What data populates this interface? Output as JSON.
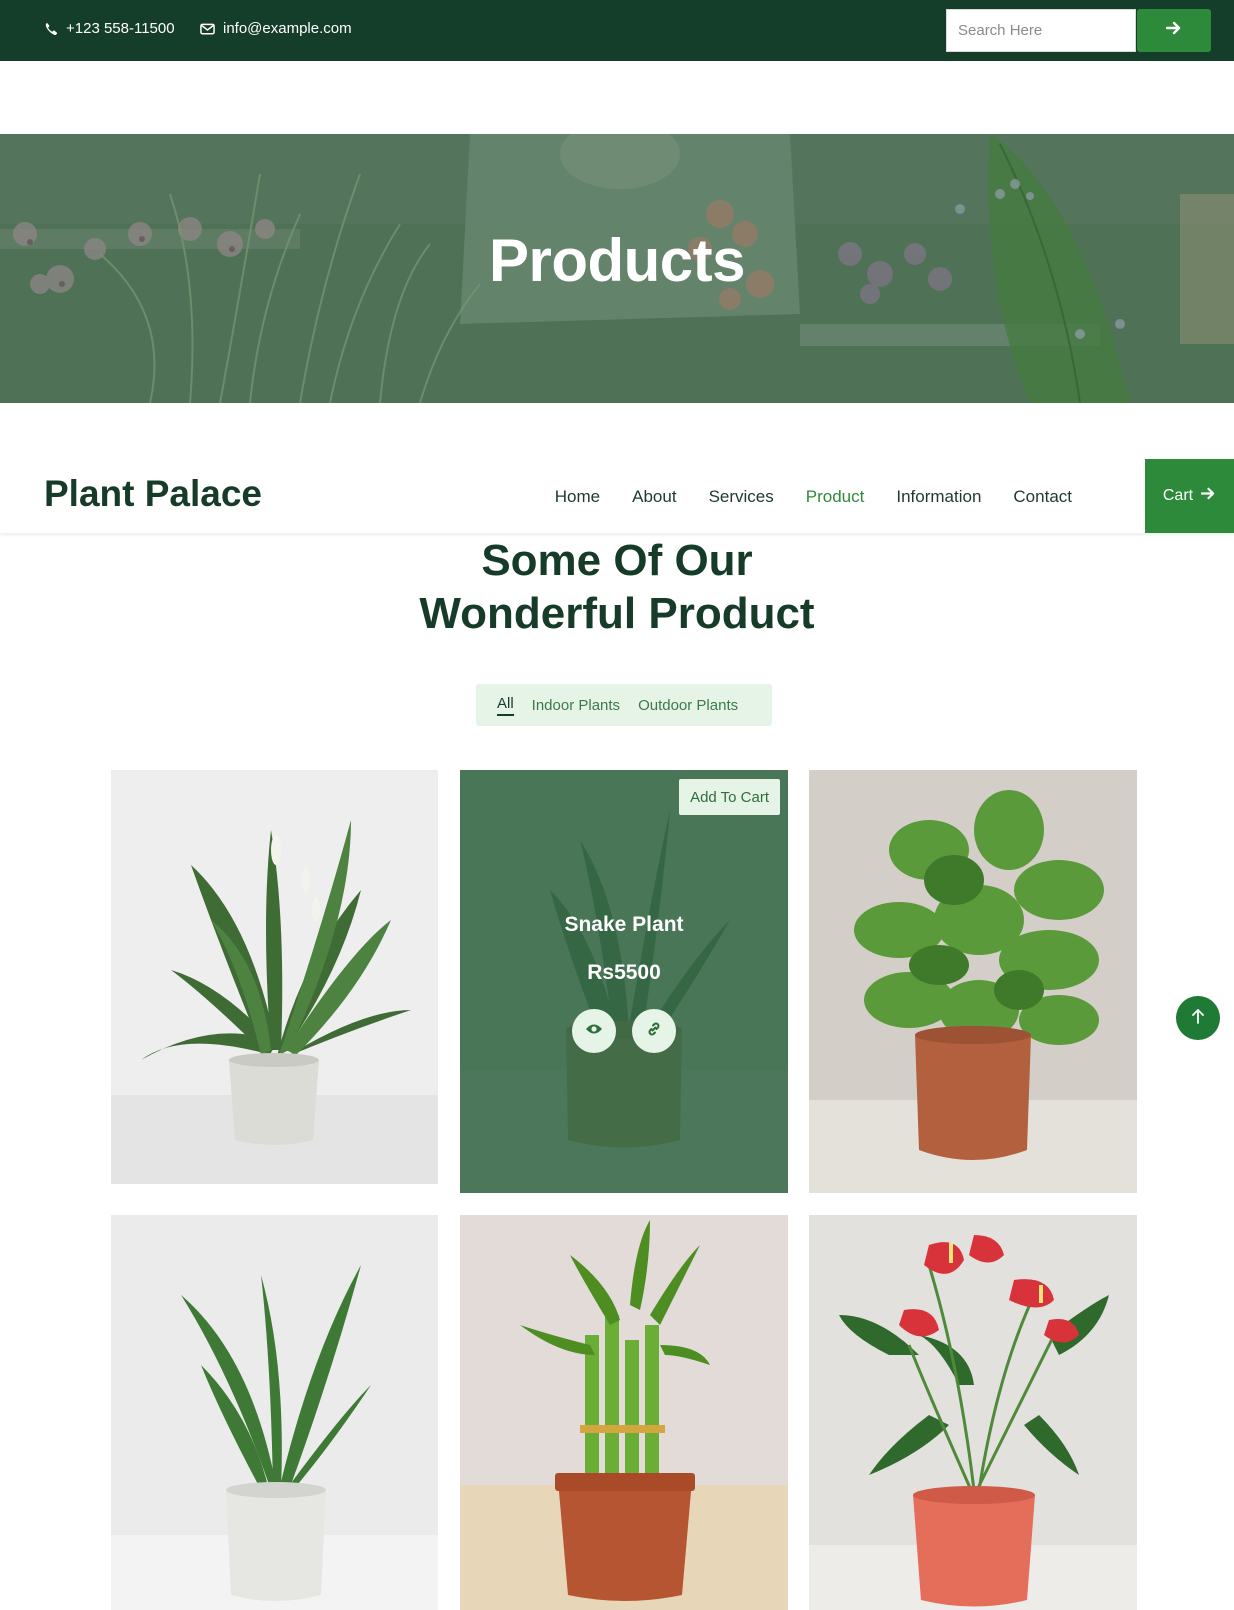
{
  "topbar": {
    "phone": "+123 558-11500",
    "email": "info@example.com",
    "search_placeholder": "Search Here"
  },
  "hero": {
    "title": "Products"
  },
  "nav": {
    "brand": "Plant Palace",
    "items": [
      {
        "label": "Home",
        "active": false
      },
      {
        "label": "About",
        "active": false
      },
      {
        "label": "Services",
        "active": false
      },
      {
        "label": "Product",
        "active": true
      },
      {
        "label": "Information",
        "active": false
      },
      {
        "label": "Contact",
        "active": false
      }
    ],
    "cart_label": "Cart"
  },
  "section": {
    "title_line1": "Some Of Our",
    "title_line2": "Wonderful Product"
  },
  "filters": [
    {
      "label": "All",
      "active": true
    },
    {
      "label": "Indoor Plants",
      "active": false
    },
    {
      "label": "Outdoor Plants",
      "active": false
    }
  ],
  "products": {
    "hovered": {
      "add_to_cart": "Add To Cart",
      "name": "Snake Plant",
      "price": "Rs5500"
    }
  },
  "icons": {
    "phone": "phone-icon",
    "email": "envelope-icon",
    "search_submit": "arrow-right-icon",
    "cart": "arrow-right-icon",
    "view": "eye-icon",
    "link": "link-icon",
    "scroll_top": "arrow-up-icon"
  },
  "colors": {
    "topbar": "#143d2a",
    "accent": "#2e8a3b",
    "heading": "#163b29",
    "pale_green": "#e6f4e7"
  }
}
